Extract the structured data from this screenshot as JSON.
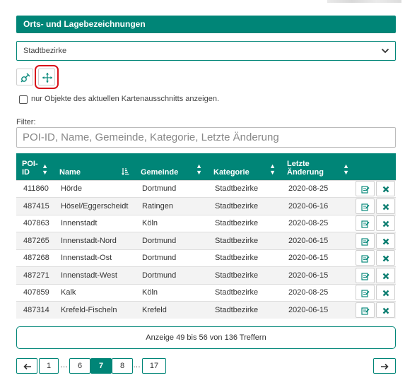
{
  "panel": {
    "title": "Orts- und Lagebezeichnungen"
  },
  "category_select": {
    "selected": "Stadtbezirke"
  },
  "toolbar": {
    "tools": [
      {
        "icon": "satellite-locate-icon"
      },
      {
        "icon": "move-arrows-icon",
        "highlighted": true
      }
    ]
  },
  "extent_checkbox": {
    "label": "nur Objekte des aktuellen Kartenausschnitts anzeigen.",
    "checked": false
  },
  "filter": {
    "label": "Filter:",
    "placeholder": "POI-ID, Name, Gemeinde, Kategorie, Letzte Änderung"
  },
  "table": {
    "columns": [
      {
        "line1": "POI-",
        "line2": "ID"
      },
      {
        "line1": "",
        "line2": "Name"
      },
      {
        "line1": "",
        "line2": "Gemeinde"
      },
      {
        "line1": "",
        "line2": "Kategorie"
      },
      {
        "line1": "Letzte",
        "line2": "Änderung"
      }
    ],
    "sorted_column": "Name",
    "rows": [
      {
        "id": "411860",
        "name": "Hörde",
        "gemeinde": "Dortmund",
        "kategorie": "Stadtbezirke",
        "datum": "2020-08-25"
      },
      {
        "id": "487415",
        "name": "Hösel/Eggerscheidt",
        "gemeinde": "Ratingen",
        "kategorie": "Stadtbezirke",
        "datum": "2020-06-16"
      },
      {
        "id": "407863",
        "name": "Innenstadt",
        "gemeinde": "Köln",
        "kategorie": "Stadtbezirke",
        "datum": "2020-08-25"
      },
      {
        "id": "487265",
        "name": "Innenstadt-Nord",
        "gemeinde": "Dortmund",
        "kategorie": "Stadtbezirke",
        "datum": "2020-06-15"
      },
      {
        "id": "487268",
        "name": "Innenstadt-Ost",
        "gemeinde": "Dortmund",
        "kategorie": "Stadtbezirke",
        "datum": "2020-06-15"
      },
      {
        "id": "487271",
        "name": "Innenstadt-West",
        "gemeinde": "Dortmund",
        "kategorie": "Stadtbezirke",
        "datum": "2020-06-15"
      },
      {
        "id": "407859",
        "name": "Kalk",
        "gemeinde": "Köln",
        "kategorie": "Stadtbezirke",
        "datum": "2020-08-25"
      },
      {
        "id": "487314",
        "name": "Krefeld-Fischeln",
        "gemeinde": "Krefeld",
        "kategorie": "Stadtbezirke",
        "datum": "2020-06-15"
      }
    ]
  },
  "result_summary": "Anzeige 49 bis 56 von 136 Treffern",
  "pagination": {
    "pages": [
      "1",
      "…",
      "6",
      "7",
      "8",
      "…",
      "17"
    ],
    "current": "7"
  },
  "colors": {
    "accent": "#008577",
    "highlight": "#d8121a",
    "edit_icon": "#0a8a7c",
    "delete_icon": "#0a7d70"
  }
}
